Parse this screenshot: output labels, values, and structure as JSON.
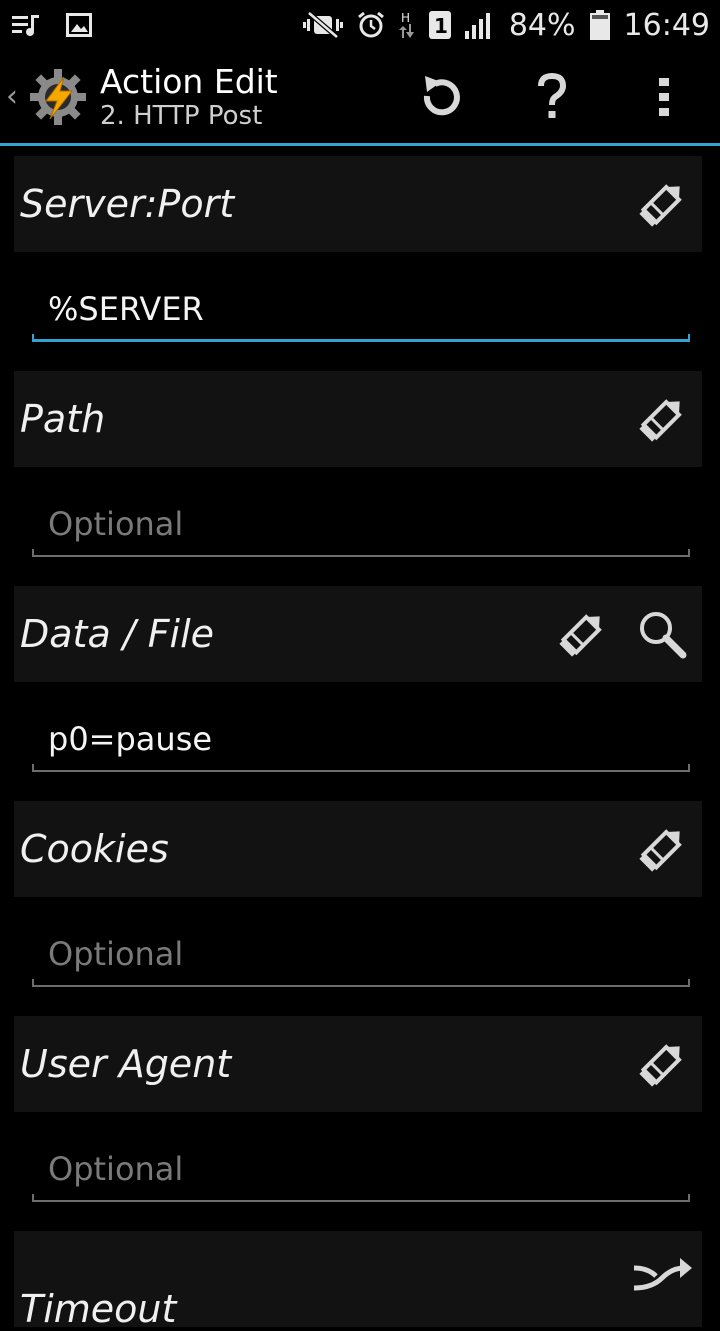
{
  "status_bar": {
    "battery_percent": "84%",
    "time": "16:49",
    "left_icons": [
      "playlist-icon",
      "image-icon"
    ],
    "right_icons": [
      "mute-icon",
      "alarm-icon",
      "data-h-icon",
      "sim-1-icon",
      "signal-icon",
      "battery-icon"
    ]
  },
  "action_bar": {
    "title": "Action Edit",
    "subtitle": "2. HTTP Post",
    "actions": [
      "undo-icon",
      "help-icon",
      "overflow-menu-icon"
    ]
  },
  "accent_color": "#33a3d6",
  "sections": [
    {
      "label": "Server:Port",
      "value": "%SERVER",
      "placeholder": "",
      "focused": true
    },
    {
      "label": "Path",
      "value": "",
      "placeholder": "Optional"
    },
    {
      "label": "Data / File",
      "value": "p0=pause",
      "placeholder": ""
    },
    {
      "label": "Cookies",
      "value": "",
      "placeholder": "Optional"
    },
    {
      "label": "User Agent",
      "value": "",
      "placeholder": "Optional"
    },
    {
      "label": "Timeout"
    }
  ]
}
